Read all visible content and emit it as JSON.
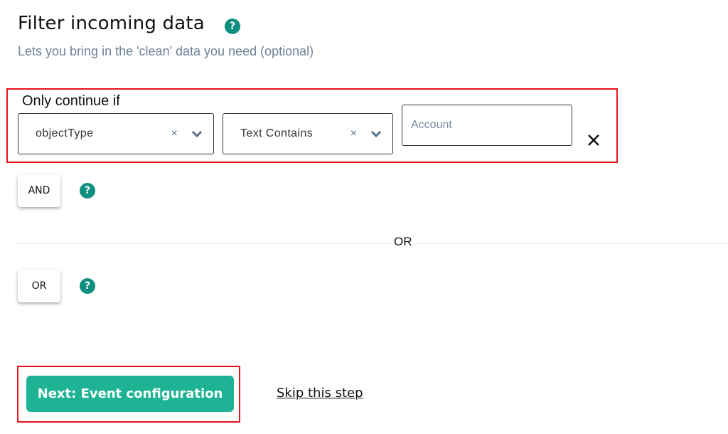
{
  "header": {
    "title": "Filter incoming data",
    "help_icon": "?",
    "subtitle": "Lets you bring in the 'clean' data you need (optional)"
  },
  "filter": {
    "label": "Only continue if",
    "field_select": {
      "value": "objectType",
      "clear_icon": "×",
      "chevron_icon": "⌄"
    },
    "operator_select": {
      "value": "Text Contains",
      "clear_icon": "×",
      "chevron_icon": "⌄"
    },
    "value_input": {
      "value": "",
      "placeholder": "Account"
    },
    "remove_icon": "✕"
  },
  "logic": {
    "and_label": "AND",
    "or_label": "OR",
    "divider_label": "OR",
    "help_icon": "?"
  },
  "footer": {
    "next_label": "Next: Event configuration",
    "skip_label": "Skip this step"
  },
  "colors": {
    "accent": "#1db394",
    "help": "#0f8f7f",
    "highlight": "#e8141c"
  }
}
